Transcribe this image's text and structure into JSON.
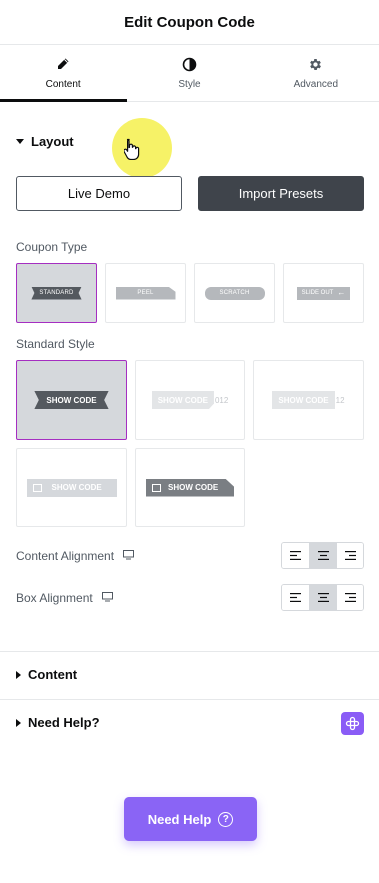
{
  "header": {
    "title": "Edit Coupon Code"
  },
  "tabs": [
    {
      "label": "Content",
      "icon": "pencil-icon",
      "active": true
    },
    {
      "label": "Style",
      "icon": "contrast-icon",
      "active": false
    },
    {
      "label": "Advanced",
      "icon": "gear-icon",
      "active": false
    }
  ],
  "layout_section": {
    "title": "Layout",
    "live_demo_label": "Live Demo",
    "import_presets_label": "Import Presets",
    "coupon_type_label": "Coupon Type",
    "coupon_types": [
      {
        "label": "STANDARD",
        "selected": true
      },
      {
        "label": "PEEL",
        "selected": false
      },
      {
        "label": "SCRATCH",
        "selected": false
      },
      {
        "label": "SLIDE OUT",
        "selected": false
      }
    ],
    "standard_style_label": "Standard Style",
    "standard_styles": [
      {
        "label": "SHOW CODE",
        "suffix": "",
        "selected": true
      },
      {
        "label": "SHOW CODE",
        "suffix": "012",
        "selected": false
      },
      {
        "label": "SHOW CODE",
        "suffix": "12",
        "selected": false
      },
      {
        "label": "SHOW CODE",
        "suffix": "",
        "selected": false
      },
      {
        "label": "SHOW CODE",
        "suffix": "",
        "selected": false
      }
    ],
    "content_alignment_label": "Content Alignment",
    "box_alignment_label": "Box Alignment",
    "alignment_selected": "center"
  },
  "content_section": {
    "title": "Content"
  },
  "need_help_section": {
    "title": "Need Help?"
  },
  "help_button": {
    "label": "Need Help",
    "icon": "question-circle-icon"
  },
  "colors": {
    "accent_purple": "#8a64f5",
    "selected_border": "#a52ec1",
    "dark_button": "#3f444b"
  }
}
